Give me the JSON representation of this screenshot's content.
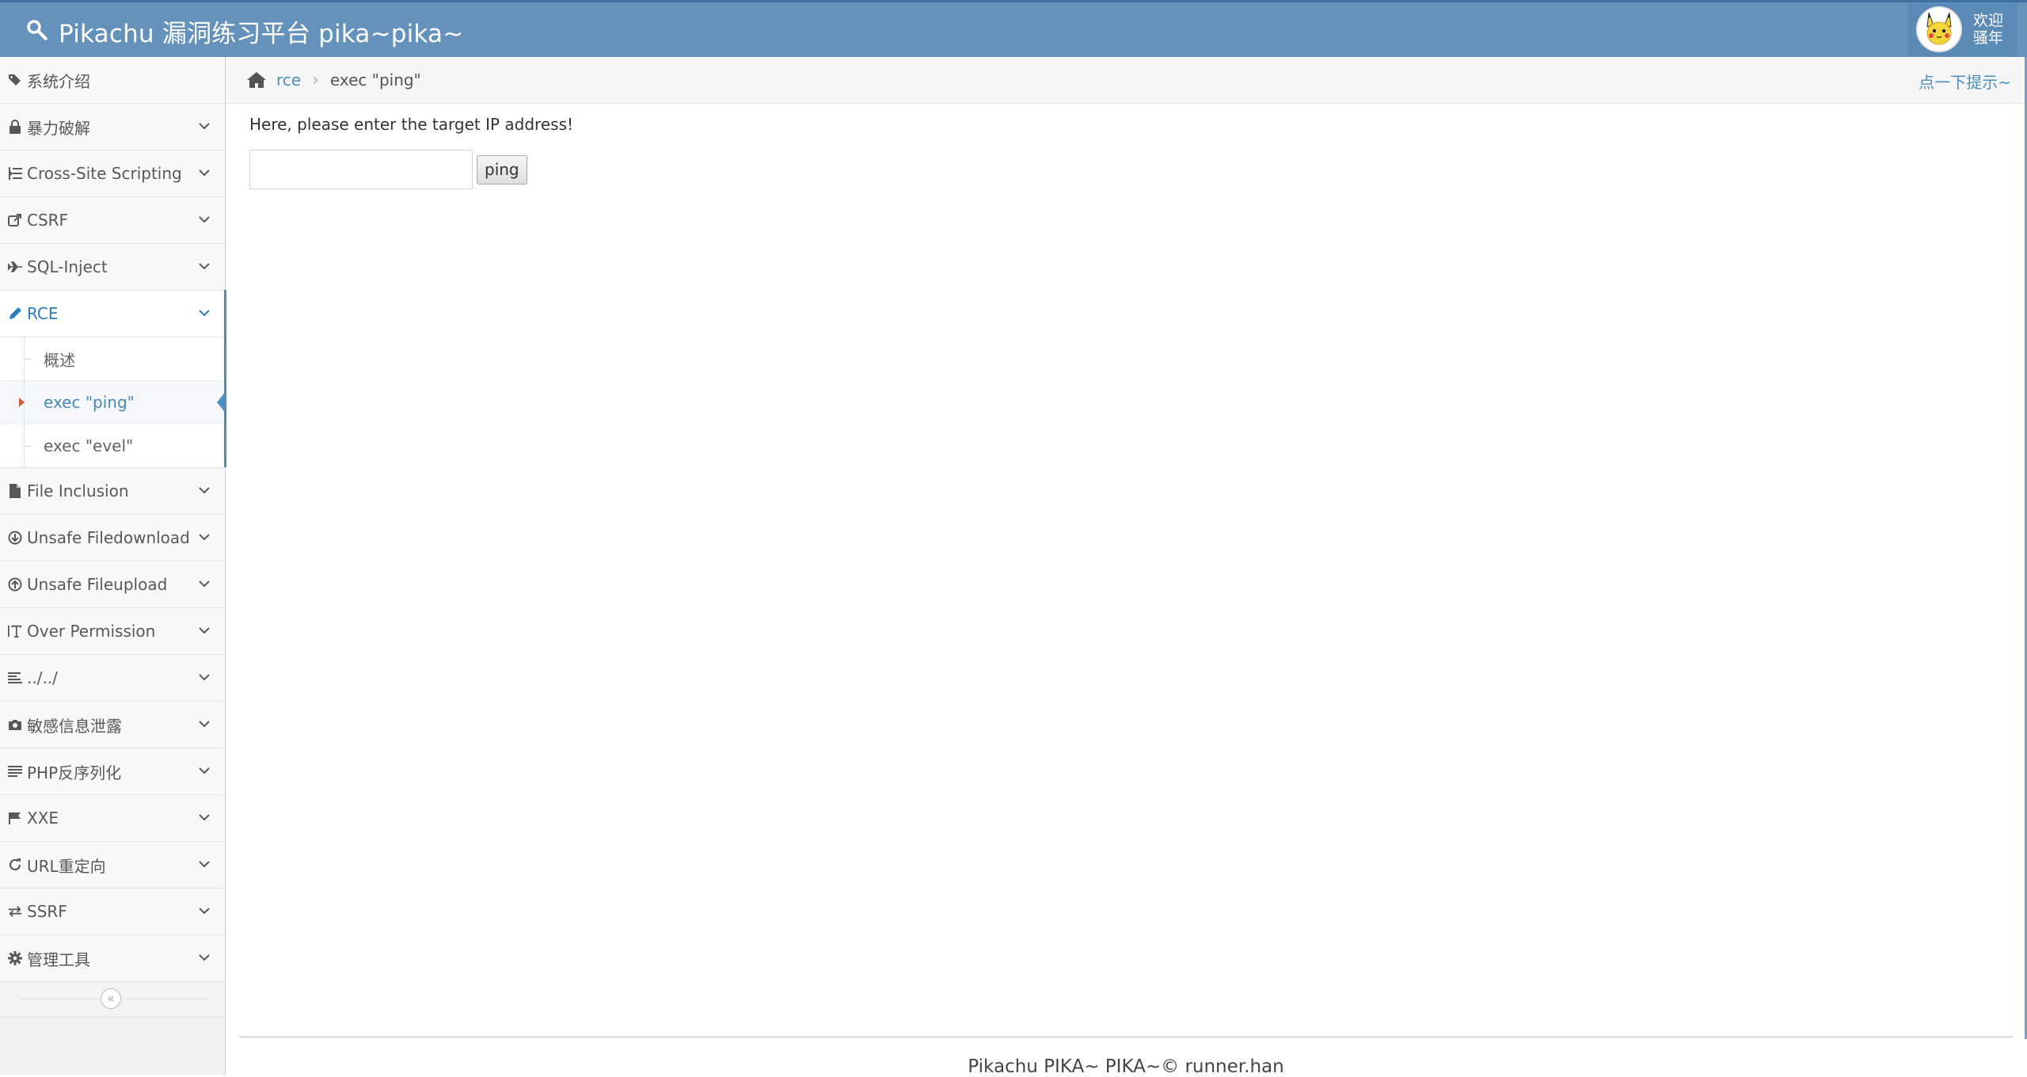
{
  "header": {
    "brand": "Pikachu 漏洞练习平台 pika~pika~",
    "user_greeting_line1": "欢迎",
    "user_greeting_line2": "骚年"
  },
  "sidebar": {
    "items": [
      {
        "label": "系统介绍",
        "icon": "tags-icon",
        "has_chevron": false
      },
      {
        "label": "暴力破解",
        "icon": "lock-icon",
        "has_chevron": true
      },
      {
        "label": "Cross-Site Scripting",
        "icon": "indent-icon",
        "has_chevron": true
      },
      {
        "label": "CSRF",
        "icon": "share-icon",
        "has_chevron": true
      },
      {
        "label": "SQL-Inject",
        "icon": "plane-icon",
        "has_chevron": true
      },
      {
        "label": "RCE",
        "icon": "pencil-icon",
        "has_chevron": true,
        "active": true,
        "children": [
          "概述",
          "exec \"ping\"",
          "exec \"evel\""
        ],
        "active_child": 1
      },
      {
        "label": "File Inclusion",
        "icon": "file-icon",
        "has_chevron": true
      },
      {
        "label": "Unsafe Filedownload",
        "icon": "download-circle-icon",
        "has_chevron": true
      },
      {
        "label": "Unsafe Fileupload",
        "icon": "upload-circle-icon",
        "has_chevron": true
      },
      {
        "label": "Over Permission",
        "icon": "text-height-icon",
        "has_chevron": true
      },
      {
        "label": "../../",
        "icon": "align-left-icon",
        "has_chevron": true
      },
      {
        "label": "敏感信息泄露",
        "icon": "camera-icon",
        "has_chevron": true
      },
      {
        "label": "PHP反序列化",
        "icon": "align-justify-icon",
        "has_chevron": true
      },
      {
        "label": "XXE",
        "icon": "flag-icon",
        "has_chevron": true
      },
      {
        "label": "URL重定向",
        "icon": "refresh-icon",
        "has_chevron": true
      },
      {
        "label": "SSRF",
        "icon": "exchange-icon",
        "has_chevron": true
      },
      {
        "label": "管理工具",
        "icon": "gear-icon",
        "has_chevron": true
      }
    ]
  },
  "breadcrumbs": {
    "link": "rce",
    "current": "exec \"ping\""
  },
  "hint_link": "点一下提示~",
  "main": {
    "prompt": "Here, please enter the target IP address!",
    "input_value": "",
    "button_label": "ping"
  },
  "footer": {
    "text": "Pikachu PIKA~ PIKA~© runner.han"
  },
  "colors": {
    "navbar": "#6592bb",
    "accent": "#4c8fbd",
    "active_caret": "#c86139"
  }
}
